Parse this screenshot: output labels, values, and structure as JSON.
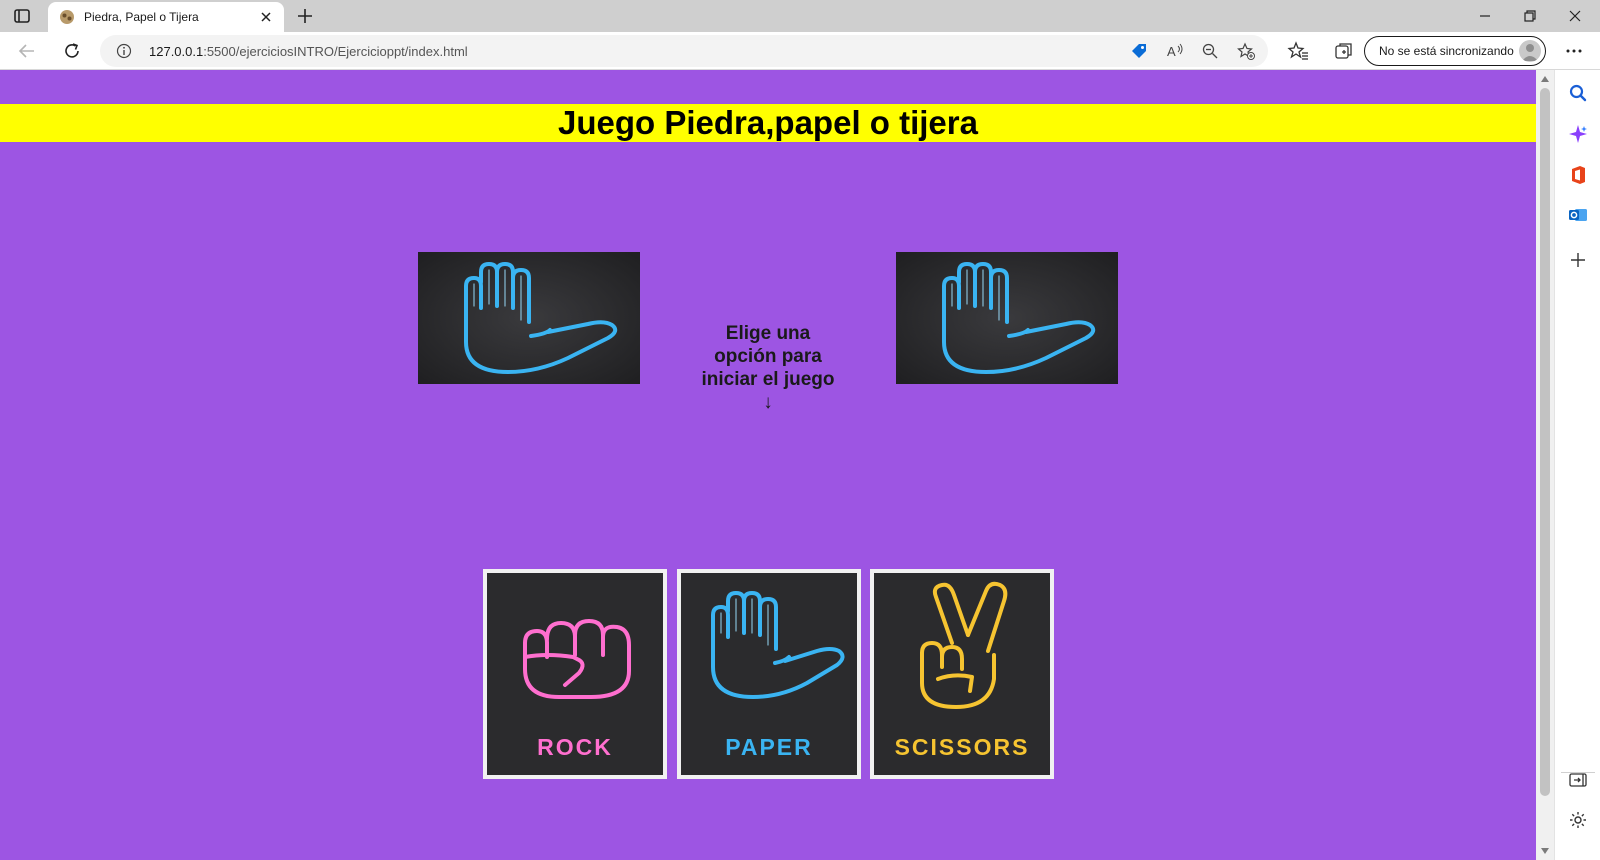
{
  "browser": {
    "tab_title": "Piedra, Papel o Tijera",
    "url_host": "127.0.0.1",
    "url_rest": ":5500/ejerciciosINTRO/Ejercicioppt/index.html",
    "sync_label": "No se está sincronizando"
  },
  "page": {
    "heading": "Juego Piedra,papel o tijera",
    "status": "Elige una opción para iniciar el juego ↓",
    "player_choice_icon": "paper-hand-icon",
    "computer_choice_icon": "paper-hand-icon"
  },
  "choices": [
    {
      "label": "ROCK",
      "icon": "rock-fist-icon",
      "color": "#ff6fcf"
    },
    {
      "label": "PAPER",
      "icon": "paper-hand-icon",
      "color": "#3ab4f2"
    },
    {
      "label": "SCISSORS",
      "icon": "scissors-hand-icon",
      "color": "#f6c431"
    }
  ],
  "colors": {
    "background": "#9d55e3",
    "banner": "#ffff00",
    "neon_pink": "#ff6fcf",
    "neon_blue": "#3ab4f2",
    "neon_yellow": "#f6c431"
  }
}
